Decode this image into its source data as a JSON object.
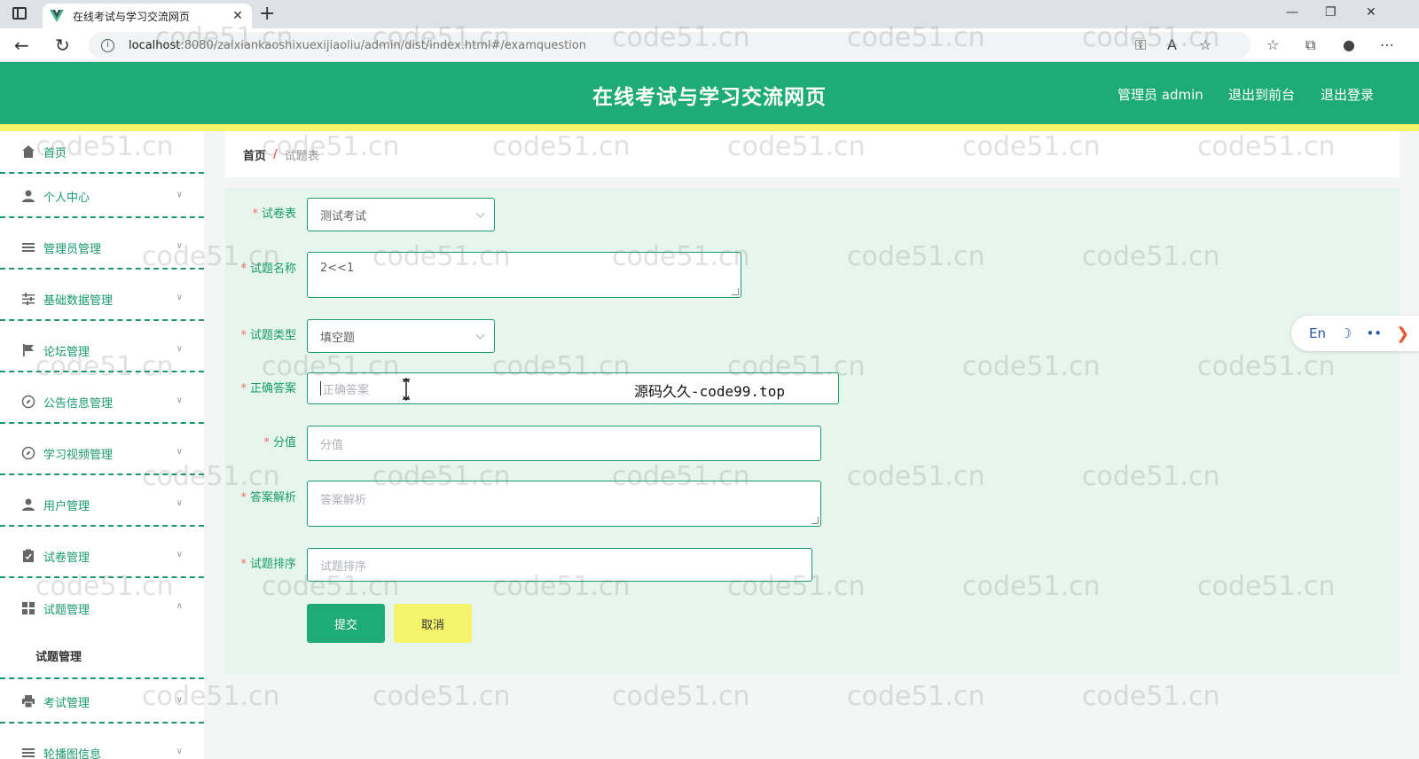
{
  "browser": {
    "tab_title": "在线考试与学习交流网页",
    "tab_close": "✕",
    "new_tab": "+",
    "url_host": "localhost",
    "url_rest": ":8080/zaixiankaoshixuexijiaoliu/admin/dist/index.html#/examquestion",
    "win_minimize": "—",
    "win_restore": "❐",
    "win_close": "✕"
  },
  "header": {
    "title": "在线考试与学习交流网页",
    "admin_label": "管理员 admin",
    "to_front": "退出到前台",
    "logout": "退出登录"
  },
  "sidebar": {
    "items": [
      {
        "label": "首页",
        "icon": "home-icon"
      },
      {
        "label": "个人中心",
        "icon": "user-icon"
      },
      {
        "label": "管理员管理",
        "icon": "list-icon"
      },
      {
        "label": "基础数据管理",
        "icon": "sliders-icon"
      },
      {
        "label": "论坛管理",
        "icon": "flag-icon"
      },
      {
        "label": "公告信息管理",
        "icon": "compass-icon"
      },
      {
        "label": "学习视频管理",
        "icon": "compass-icon"
      },
      {
        "label": "用户管理",
        "icon": "user-icon"
      },
      {
        "label": "试卷管理",
        "icon": "clipboard-icon"
      },
      {
        "label": "试题管理",
        "icon": "grid-icon"
      },
      {
        "label": "考试管理",
        "icon": "printer-icon"
      },
      {
        "label": "轮播图信息",
        "icon": "list-icon"
      }
    ],
    "sub_item": "试题管理"
  },
  "breadcrumb": {
    "home": "首页",
    "separator": "/",
    "current": "试题表"
  },
  "form": {
    "paper_label": "试卷表",
    "paper_value": "测试考试",
    "name_label": "试题名称",
    "name_value": "2<<1",
    "type_label": "试题类型",
    "type_value": "填空题",
    "answer_label": "正确答案",
    "answer_placeholder": "正确答案",
    "score_label": "分值",
    "score_placeholder": "分值",
    "analysis_label": "答案解析",
    "analysis_placeholder": "答案解析",
    "order_label": "试题排序",
    "order_placeholder": "试题排序",
    "required_mark": "*",
    "submit": "提交",
    "cancel": "取消"
  },
  "overlay_text": "源码久久-code99.top",
  "lang_widget": {
    "lang": "En",
    "moon": "☽",
    "dots": "••",
    "arrow": "❯"
  },
  "watermark": "code51.cn",
  "colors": {
    "brand_green": "#1eab77",
    "accent_yellow": "#f5f36a",
    "panel_bg": "#e6f6ef"
  }
}
